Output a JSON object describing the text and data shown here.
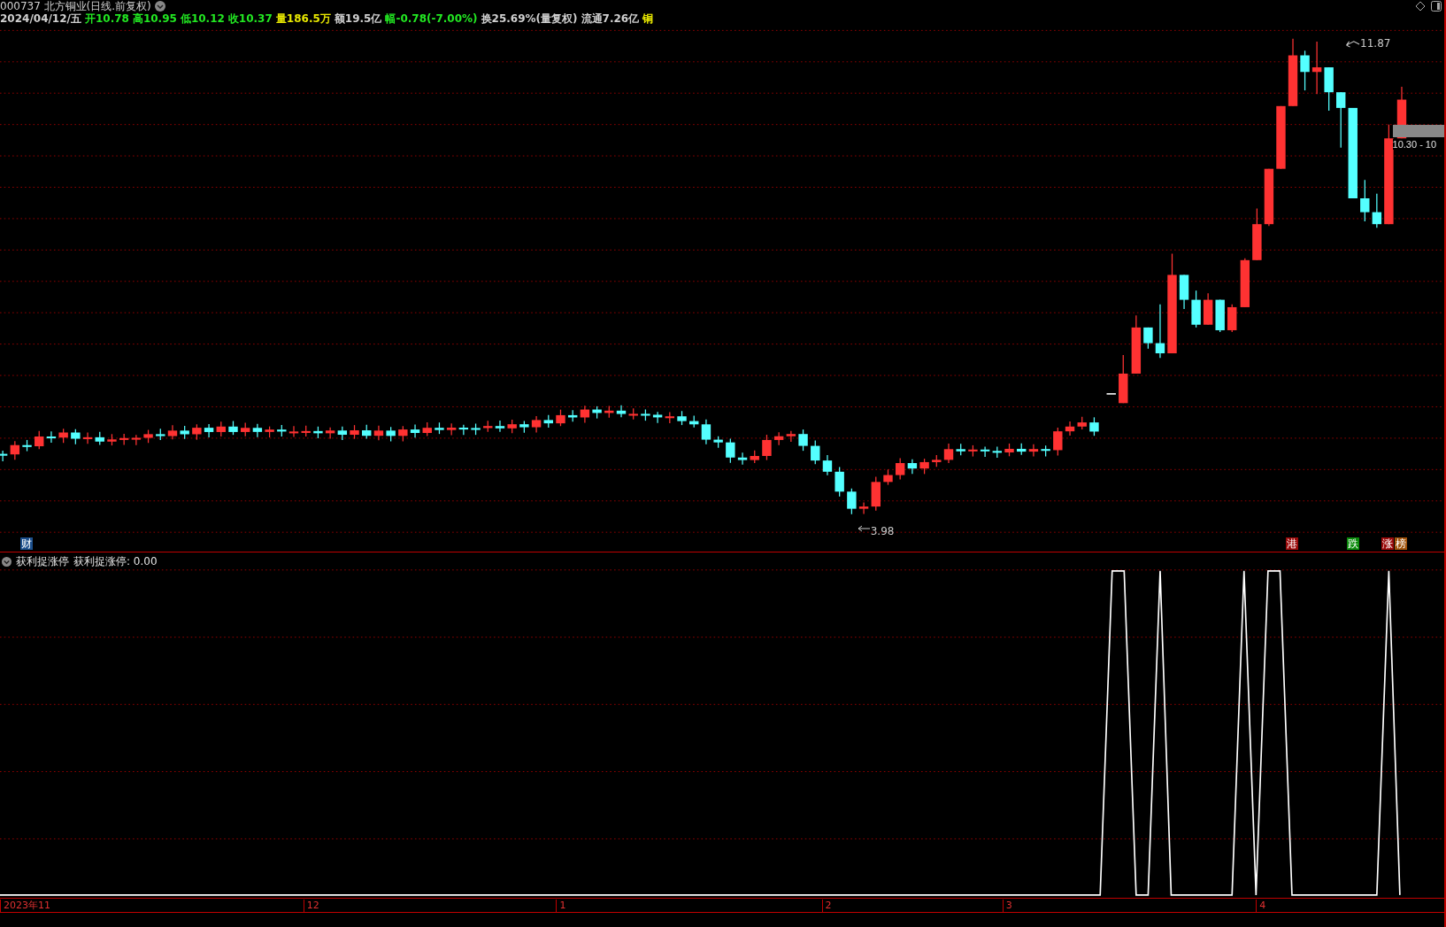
{
  "header": {
    "title": "000737 北方铜业(日线.前复权)",
    "quotes": [
      {
        "text": "2024/04/12/五",
        "color": "#d0d0d0"
      },
      {
        "text": "开10.78",
        "color": "#22e822"
      },
      {
        "text": "高10.95",
        "color": "#22e822"
      },
      {
        "text": "低10.12",
        "color": "#22e822"
      },
      {
        "text": "收10.37",
        "color": "#22e822"
      },
      {
        "text": "量186.5万",
        "color": "#e8e800"
      },
      {
        "text": "额19.5亿",
        "color": "#d0d0d0"
      },
      {
        "text": "幅-0.78(-7.00%)",
        "color": "#22e822"
      },
      {
        "text": "换25.69%(量复权)",
        "color": "#d0d0d0"
      },
      {
        "text": "流通7.26亿",
        "color": "#d0d0d0"
      },
      {
        "text": "铜",
        "color": "#e8e800"
      }
    ]
  },
  "price_chart": {
    "high_label": "11.87",
    "low_label": "3.98",
    "current_label": "10.30 - 10",
    "badges": [
      {
        "text": "财",
        "color": "#1c4f8c"
      },
      {
        "text": "港",
        "color": "#9a0a0a"
      },
      {
        "text": "跌",
        "color": "#0a8a0a"
      },
      {
        "text": "涨",
        "color": "#9a0a0a"
      },
      {
        "text": "榜",
        "color": "#a0520a"
      }
    ]
  },
  "indicator": {
    "name": "获利捉涨停",
    "readout": "获利捉涨停: 0.00"
  },
  "x_axis": [
    "2023年11",
    "12",
    "1",
    "2",
    "3",
    "4"
  ]
}
